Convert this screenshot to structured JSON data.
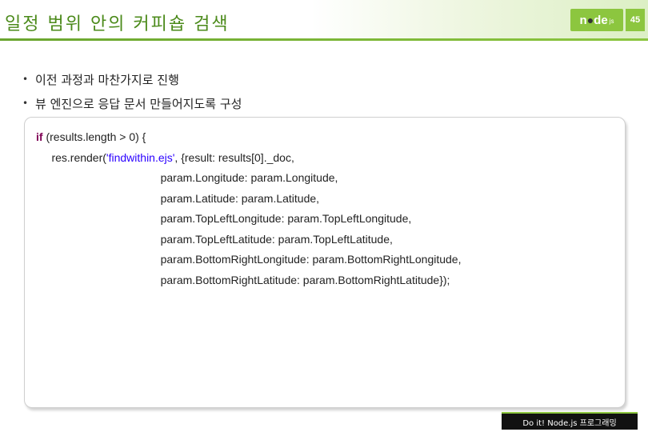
{
  "slide": {
    "title": "일정 범위 안의 커피숍 검색",
    "page_number": "45",
    "logo": {
      "pre": "n",
      "dot": "●",
      "post": "de",
      "js": "js"
    }
  },
  "bullets": [
    {
      "marker": "•",
      "text": "이전 과정과 마찬가지로 진행"
    },
    {
      "marker": "•",
      "text": "뷰 엔진으로 응답 문서 만들어지도록 구성"
    }
  ],
  "code": {
    "lines": [
      {
        "kw": "if",
        "rest": " (results.length > 0) {"
      },
      {
        "pre": "     res.render(",
        "str": "'findwithin.ejs'",
        "post": ", {result: results[0]._doc,"
      },
      {
        "text": "                                        param.Longitude: param.Longitude,"
      },
      {
        "text": "                                        param.Latitude: param.Latitude,"
      },
      {
        "text": "                                        param.TopLeftLongitude: param.TopLeftLongitude,"
      },
      {
        "text": "                                        param.TopLeftLatitude: param.TopLeftLatitude,"
      },
      {
        "text": "                                        param.BottomRightLongitude: param.BottomRightLongitude,"
      },
      {
        "text": "                                        param.BottomRightLatitude: param.BottomRightLatitude});"
      }
    ]
  },
  "footer": {
    "text": "Do it! Node.js 프로그래밍"
  },
  "colors": {
    "accent": "#8cc63f",
    "title": "#4b8a1a"
  }
}
